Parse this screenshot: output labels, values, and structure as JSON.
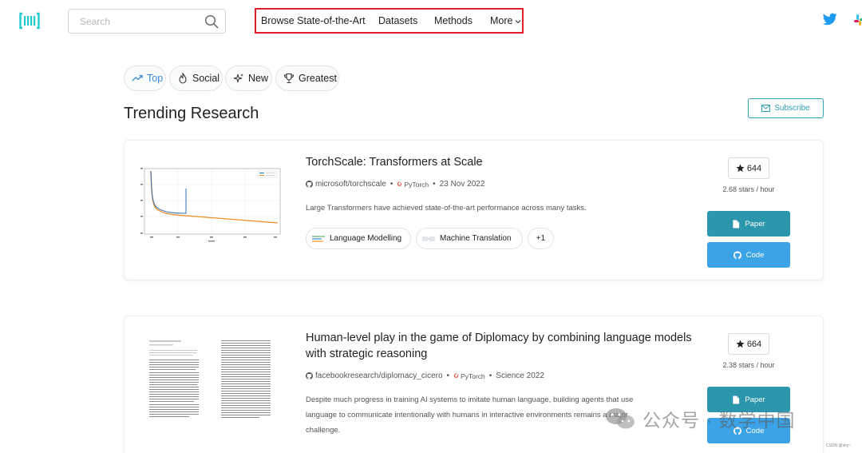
{
  "search": {
    "placeholder": "Search"
  },
  "nav": {
    "items": [
      "Browse State-of-the-Art",
      "Datasets",
      "Methods",
      "More"
    ],
    "highlight_color": "#e3202a"
  },
  "tabs": [
    {
      "label": "Top",
      "icon": "trending-up-icon",
      "active": true
    },
    {
      "label": "Social",
      "icon": "flame-icon",
      "active": false
    },
    {
      "label": "New",
      "icon": "sparkle-icon",
      "active": false
    },
    {
      "label": "Greatest",
      "icon": "trophy-icon",
      "active": false
    }
  ],
  "heading": "Trending Research",
  "subscribe_label": "Subscribe",
  "papers": [
    {
      "title": "TorchScale: Transformers at Scale",
      "repo": "microsoft/torchscale",
      "framework": "PyTorch",
      "date": "23 Nov 2022",
      "abstract": "Large Transformers have achieved state-of-the-art performance across many tasks.",
      "tasks": [
        "Language Modelling",
        "Machine Translation"
      ],
      "extra_tasks": "+1",
      "stars": "644",
      "rate": "2.68 stars / hour",
      "paper_label": "Paper",
      "code_label": "Code"
    },
    {
      "title_line1": "Human-level play in the game of Diplomacy by combining language models",
      "title_line2": "with strategic reasoning",
      "repo": "facebookresearch/diplomacy_cicero",
      "framework": "PyTorch",
      "date": "Science 2022",
      "abstract_line1": "Despite much progress in training AI systems to imitate human language, building agents that use",
      "abstract_line2": "language to communicate intentionally with humans in interactive environments remains a major",
      "abstract_line3": "challenge.",
      "stars": "664",
      "rate": "2.38 stars / hour",
      "paper_label": "Paper",
      "code_label": "Code"
    }
  ],
  "watermark": "公众号 · 数学中国",
  "credit": "CSDN @shy~",
  "colors": {
    "accent_teal": "#2b96ac",
    "accent_blue": "#3ba3e6",
    "active_tab": "#3a8bd6"
  }
}
